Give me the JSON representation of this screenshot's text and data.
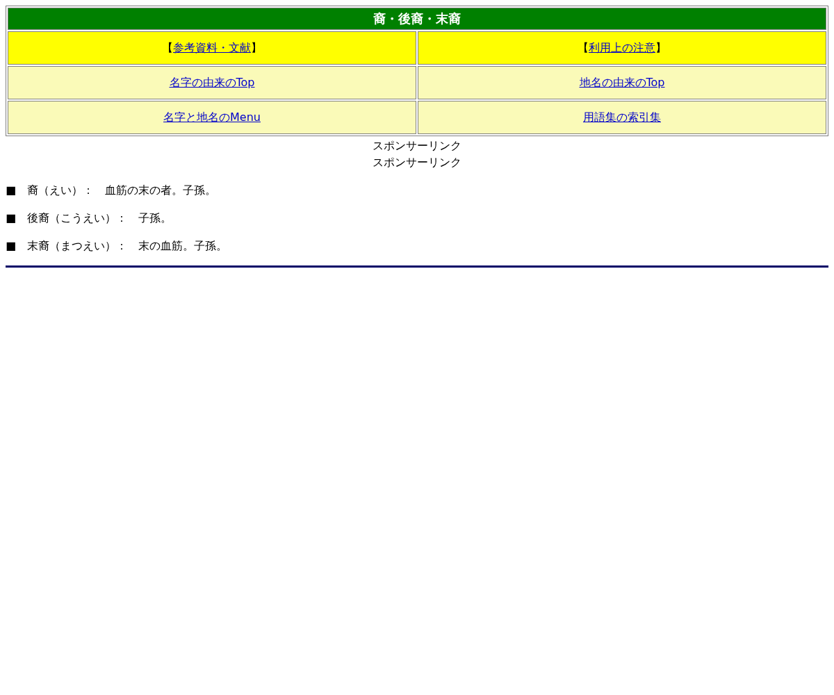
{
  "title": "裔・後裔・末裔",
  "nav_rows": [
    {
      "kind": "highlight",
      "cells": [
        {
          "prefix": "【",
          "link": "参考資料・文献",
          "suffix": "】"
        },
        {
          "prefix": "【",
          "link": "利用上の注意",
          "suffix": "】"
        }
      ]
    },
    {
      "kind": "plain",
      "cells": [
        {
          "link": "名字の由来のTop"
        },
        {
          "link": "地名の由来のTop"
        }
      ]
    },
    {
      "kind": "plain",
      "cells": [
        {
          "link": "名字と地名のMenu"
        },
        {
          "link": "用語集の索引集"
        }
      ]
    }
  ],
  "sponsor_labels": [
    "スポンサーリンク",
    "スポンサーリンク"
  ],
  "entries": [
    "■　裔（えい）：　血筋の末の者。子孫。",
    "■　後裔（こうえい）：　子孫。",
    "■　末裔（まつえい）：　末の血筋。子孫。"
  ]
}
